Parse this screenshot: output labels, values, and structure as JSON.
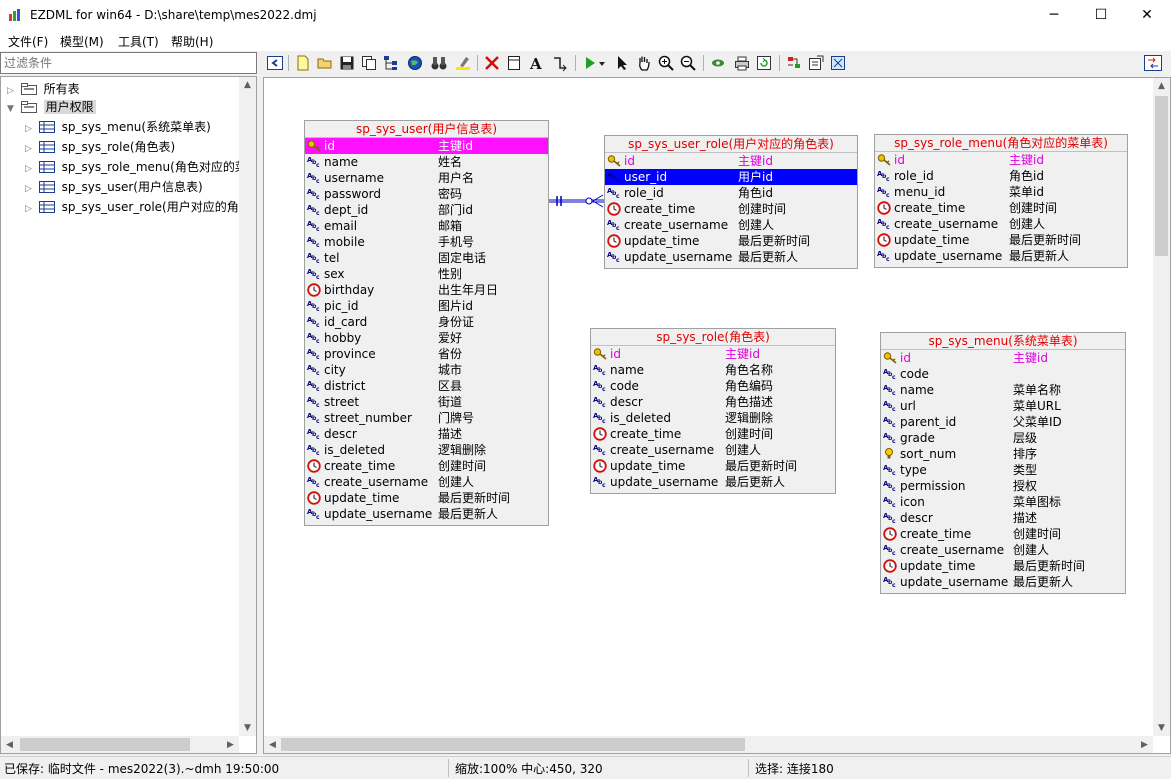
{
  "window": {
    "title": "EZDML for win64 - D:\\share\\temp\\mes2022.dmj",
    "minimize": "─",
    "maximize": "☐",
    "close": "✕"
  },
  "menu": [
    "文件(F)",
    "模型(M)",
    "工具(T)",
    "帮助(H)"
  ],
  "filter": {
    "placeholder": "过滤条件"
  },
  "tree": {
    "roots": [
      {
        "label": "所有表"
      },
      {
        "label": "用户权限"
      }
    ],
    "children": [
      "sp_sys_menu(系统菜单表)",
      "sp_sys_role(角色表)",
      "sp_sys_role_menu(角色对应的菜",
      "sp_sys_user(用户信息表)",
      "sp_sys_user_role(用户对应的角色"
    ]
  },
  "entities": {
    "user": {
      "title": "sp_sys_user(用户信息表)",
      "fields": [
        [
          "key",
          "id",
          "主键id"
        ],
        [
          "abc",
          "name",
          "姓名"
        ],
        [
          "abc",
          "username",
          "用户名"
        ],
        [
          "abc",
          "password",
          "密码"
        ],
        [
          "abc",
          "dept_id",
          "部门id"
        ],
        [
          "abc",
          "email",
          "邮箱"
        ],
        [
          "abc",
          "mobile",
          "手机号"
        ],
        [
          "abc",
          "tel",
          "固定电话"
        ],
        [
          "abc",
          "sex",
          "性别"
        ],
        [
          "clock",
          "birthday",
          "出生年月日"
        ],
        [
          "abc",
          "pic_id",
          "图片id"
        ],
        [
          "abc",
          "id_card",
          "身份证"
        ],
        [
          "abc",
          "hobby",
          "爱好"
        ],
        [
          "abc",
          "province",
          "省份"
        ],
        [
          "abc",
          "city",
          "城市"
        ],
        [
          "abc",
          "district",
          "区县"
        ],
        [
          "abc",
          "street",
          "街道"
        ],
        [
          "abc",
          "street_number",
          "门牌号"
        ],
        [
          "abc",
          "descr",
          "描述"
        ],
        [
          "abc",
          "is_deleted",
          "逻辑删除"
        ],
        [
          "clock",
          "create_time",
          "创建时间"
        ],
        [
          "abc",
          "create_username",
          "创建人"
        ],
        [
          "clock",
          "update_time",
          "最后更新时间"
        ],
        [
          "abc",
          "update_username",
          "最后更新人"
        ]
      ]
    },
    "user_role": {
      "title": "sp_sys_user_role(用户对应的角色表)",
      "fields": [
        [
          "key",
          "id",
          "主键id"
        ],
        [
          "abc",
          "user_id",
          "用户id"
        ],
        [
          "abc",
          "role_id",
          "角色id"
        ],
        [
          "clock",
          "create_time",
          "创建时间"
        ],
        [
          "abc",
          "create_username",
          "创建人"
        ],
        [
          "clock",
          "update_time",
          "最后更新时间"
        ],
        [
          "abc",
          "update_username",
          "最后更新人"
        ]
      ]
    },
    "role_menu": {
      "title": "sp_sys_role_menu(角色对应的菜单表)",
      "fields": [
        [
          "key",
          "id",
          "主键id"
        ],
        [
          "abc",
          "role_id",
          "角色id"
        ],
        [
          "abc",
          "menu_id",
          "菜单id"
        ],
        [
          "clock",
          "create_time",
          "创建时间"
        ],
        [
          "abc",
          "create_username",
          "创建人"
        ],
        [
          "clock",
          "update_time",
          "最后更新时间"
        ],
        [
          "abc",
          "update_username",
          "最后更新人"
        ]
      ]
    },
    "role": {
      "title": "sp_sys_role(角色表)",
      "fields": [
        [
          "key",
          "id",
          "主键id"
        ],
        [
          "abc",
          "name",
          "角色名称"
        ],
        [
          "abc",
          "code",
          "角色编码"
        ],
        [
          "abc",
          "descr",
          "角色描述"
        ],
        [
          "abc",
          "is_deleted",
          "逻辑删除"
        ],
        [
          "clock",
          "create_time",
          "创建时间"
        ],
        [
          "abc",
          "create_username",
          "创建人"
        ],
        [
          "clock",
          "update_time",
          "最后更新时间"
        ],
        [
          "abc",
          "update_username",
          "最后更新人"
        ]
      ]
    },
    "menu": {
      "title": "sp_sys_menu(系统菜单表)",
      "fields": [
        [
          "key",
          "id",
          "主键id"
        ],
        [
          "abc",
          "code",
          ""
        ],
        [
          "abc",
          "name",
          "菜单名称"
        ],
        [
          "abc",
          "url",
          "菜单URL"
        ],
        [
          "abc",
          "parent_id",
          "父菜单ID"
        ],
        [
          "abc",
          "grade",
          "层级"
        ],
        [
          "bulb",
          "sort_num",
          "排序"
        ],
        [
          "abc",
          "type",
          "类型"
        ],
        [
          "abc",
          "permission",
          "授权"
        ],
        [
          "abc",
          "icon",
          "菜单图标"
        ],
        [
          "abc",
          "descr",
          "描述"
        ],
        [
          "clock",
          "create_time",
          "创建时间"
        ],
        [
          "abc",
          "create_username",
          "创建人"
        ],
        [
          "clock",
          "update_time",
          "最后更新时间"
        ],
        [
          "abc",
          "update_username",
          "最后更新人"
        ]
      ]
    }
  },
  "status": {
    "saved": "已保存: 临时文件 - mes2022(3).~dmh 19:50:00",
    "zoom": "缩放:100% 中心:450, 320",
    "selection": "选择: 连接180"
  }
}
